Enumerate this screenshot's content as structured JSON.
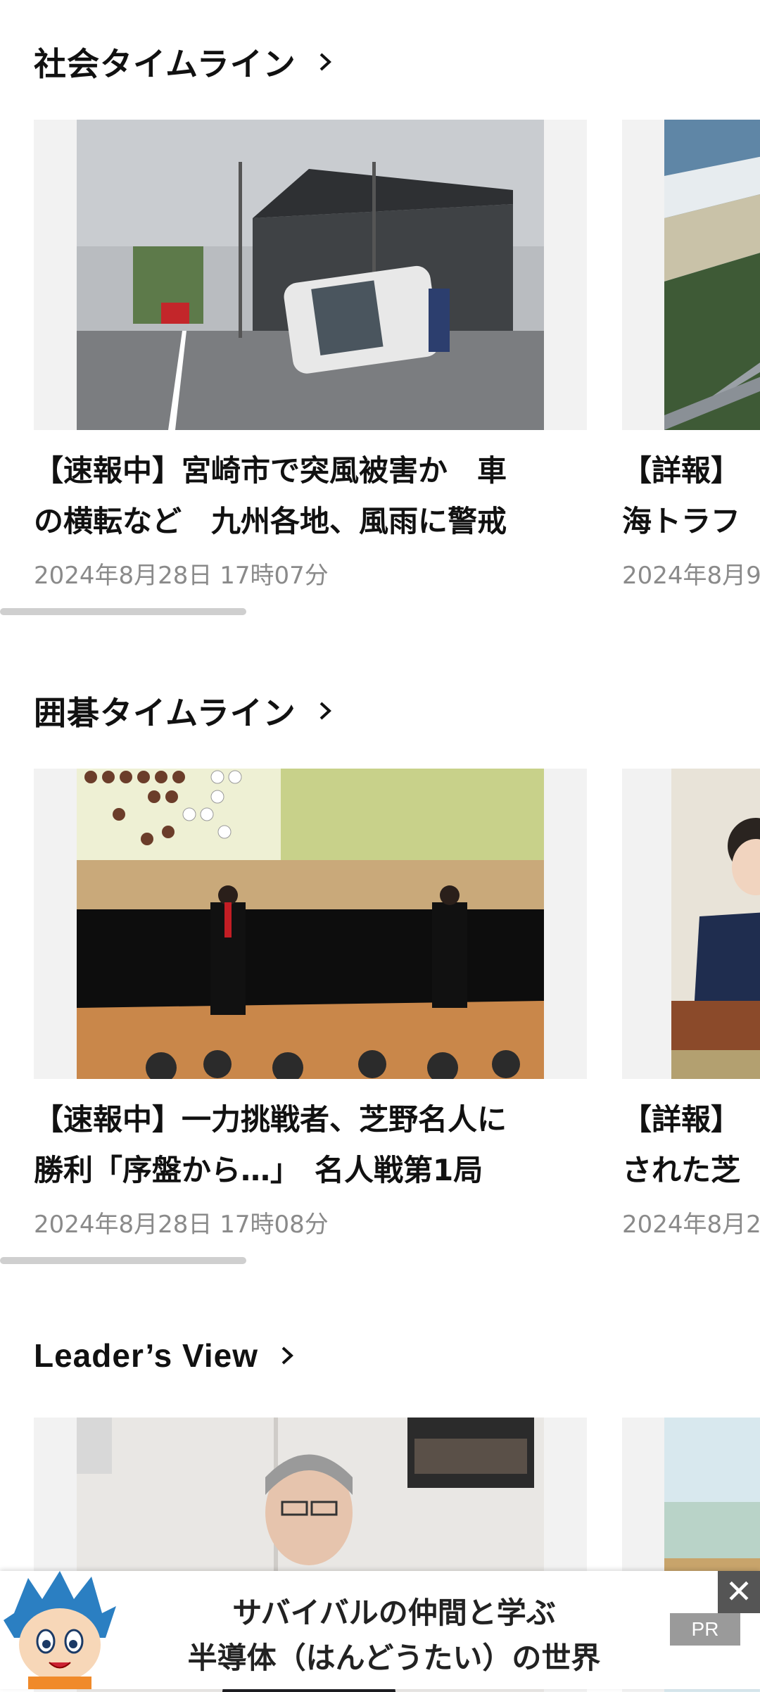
{
  "sections": [
    {
      "title": "社会タイムライン",
      "card": {
        "headline_line1": "【速報中】宮崎市で突風被害か　車",
        "headline_line2": "の横転など　九州各地、風雨に警戒",
        "date": "2024年8月28日 17時07分"
      },
      "peek": {
        "line1": "【詳報】",
        "line2": "海トラフ",
        "date": "2024年8月9"
      }
    },
    {
      "title": "囲碁タイムライン",
      "card": {
        "headline_line1": "【速報中】一力挑戦者、芝野名人に",
        "headline_line2": "勝利「序盤から…」　名人戦第1局",
        "date": "2024年8月28日 17時08分"
      },
      "peek": {
        "line1": "【詳報】",
        "line2": "された芝",
        "date": "2024年8月2"
      }
    },
    {
      "title": "Leader’s View"
    }
  ],
  "ad": {
    "line1": "サバイバルの仲間と学ぶ",
    "line2": "半導体（はんどうたい）の世界",
    "pr_label": "PR",
    "close_glyph": "✕"
  }
}
